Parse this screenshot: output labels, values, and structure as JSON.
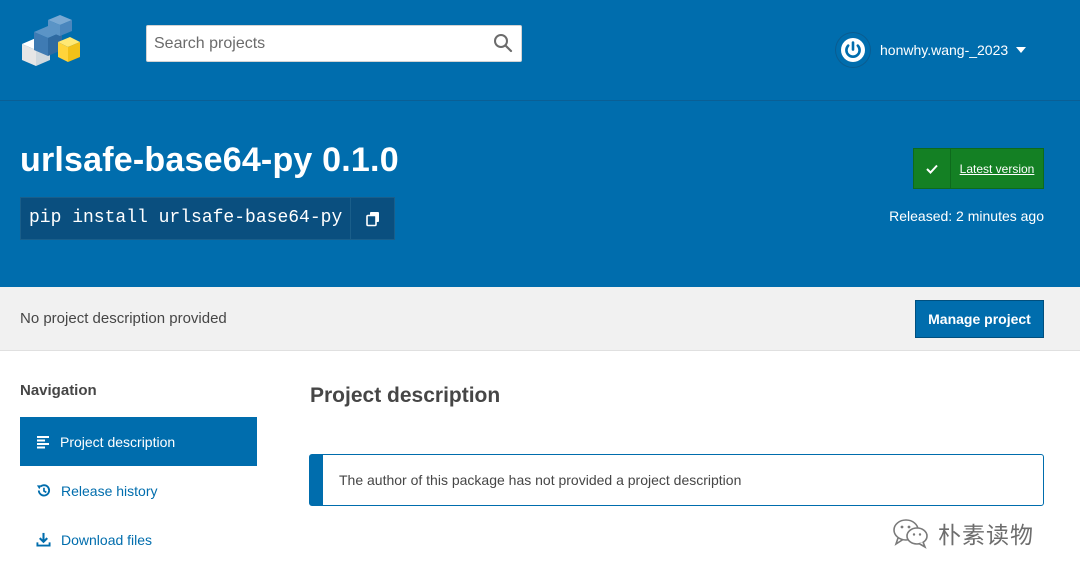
{
  "header": {
    "logo_icon": "pypi-cubes-logo",
    "search_placeholder": "Search projects",
    "search_icon": "search-icon",
    "user": {
      "avatar_icon": "user-avatar-icon",
      "name": "honwhy.wang-_2023",
      "menu_icon": "caret-down-icon"
    }
  },
  "banner": {
    "title": "urlsafe-base64-py 0.1.0",
    "install_command": "pip install urlsafe-base64-py",
    "copy_icon": "copy-icon",
    "latest_badge": {
      "icon": "check-icon",
      "label": "Latest version"
    },
    "released": "Released: 2 minutes ago"
  },
  "summary": {
    "text": "No project description provided",
    "manage_button": "Manage project"
  },
  "sidebar": {
    "heading": "Navigation",
    "items": [
      {
        "label": "Project description",
        "icon": "align-left-icon",
        "active": true
      },
      {
        "label": "Release history",
        "icon": "history-icon",
        "active": false
      },
      {
        "label": "Download files",
        "icon": "download-icon",
        "active": false
      }
    ]
  },
  "main": {
    "heading": "Project description",
    "callout": "The author of this package has not provided a project description"
  },
  "watermark": {
    "icon": "wechat-icon",
    "text": "朴素读物"
  },
  "colors": {
    "primary": "#006dad",
    "success": "#148024",
    "summary_bg": "#f1f1f1",
    "text": "#464646"
  }
}
